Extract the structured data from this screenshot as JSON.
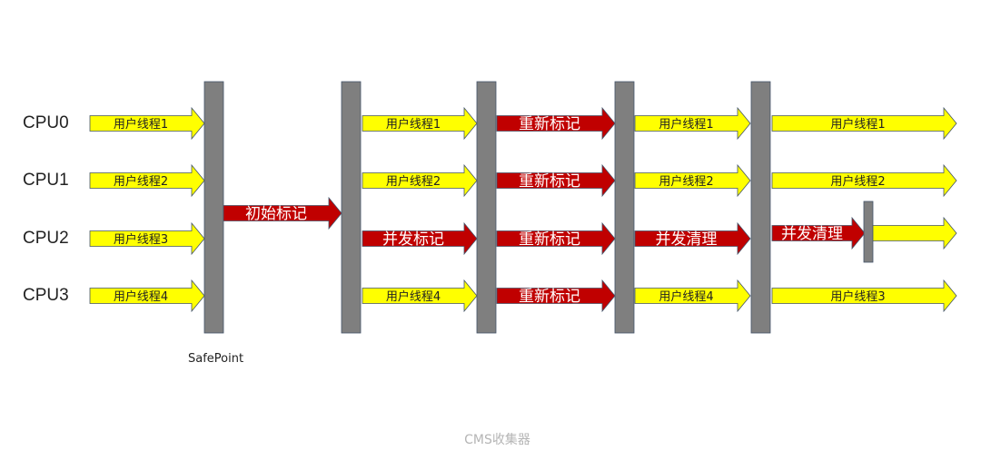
{
  "colors": {
    "user_fill": "#ffff00",
    "gc_fill": "#c00000",
    "bar_fill": "#7f7f7f",
    "arrow_stroke": "#44546a",
    "user_text": "#222222",
    "gc_text": "#ffffff",
    "caption": "#b5b5b5"
  },
  "cpus": [
    "CPU0",
    "CPU1",
    "CPU2",
    "CPU3"
  ],
  "safepoint_label": "SafePoint",
  "caption": "CMS收集器",
  "phases": [
    {
      "rows": [
        "用户线程1",
        "用户线程2",
        "用户线程3",
        "用户线程4"
      ],
      "kind": [
        "user",
        "user",
        "user",
        "user"
      ]
    },
    {
      "rows": [
        "初始标记"
      ],
      "kind": [
        "gc"
      ]
    },
    {
      "rows": [
        "用户线程1",
        "用户线程2",
        "并发标记",
        "用户线程4"
      ],
      "kind": [
        "user",
        "user",
        "gc",
        "user"
      ]
    },
    {
      "rows": [
        "重新标记",
        "重新标记",
        "重新标记",
        "重新标记"
      ],
      "kind": [
        "gc",
        "gc",
        "gc",
        "gc"
      ]
    },
    {
      "rows": [
        "用户线程1",
        "用户线程2",
        "并发清理",
        "用户线程4"
      ],
      "kind": [
        "user",
        "user",
        "gc",
        "user"
      ]
    },
    {
      "rows": [
        "用户线程1",
        "用户线程2",
        "并发清理",
        "",
        "用户线程3"
      ],
      "kind": [
        "user",
        "user",
        "gc",
        "user",
        "user"
      ]
    }
  ]
}
